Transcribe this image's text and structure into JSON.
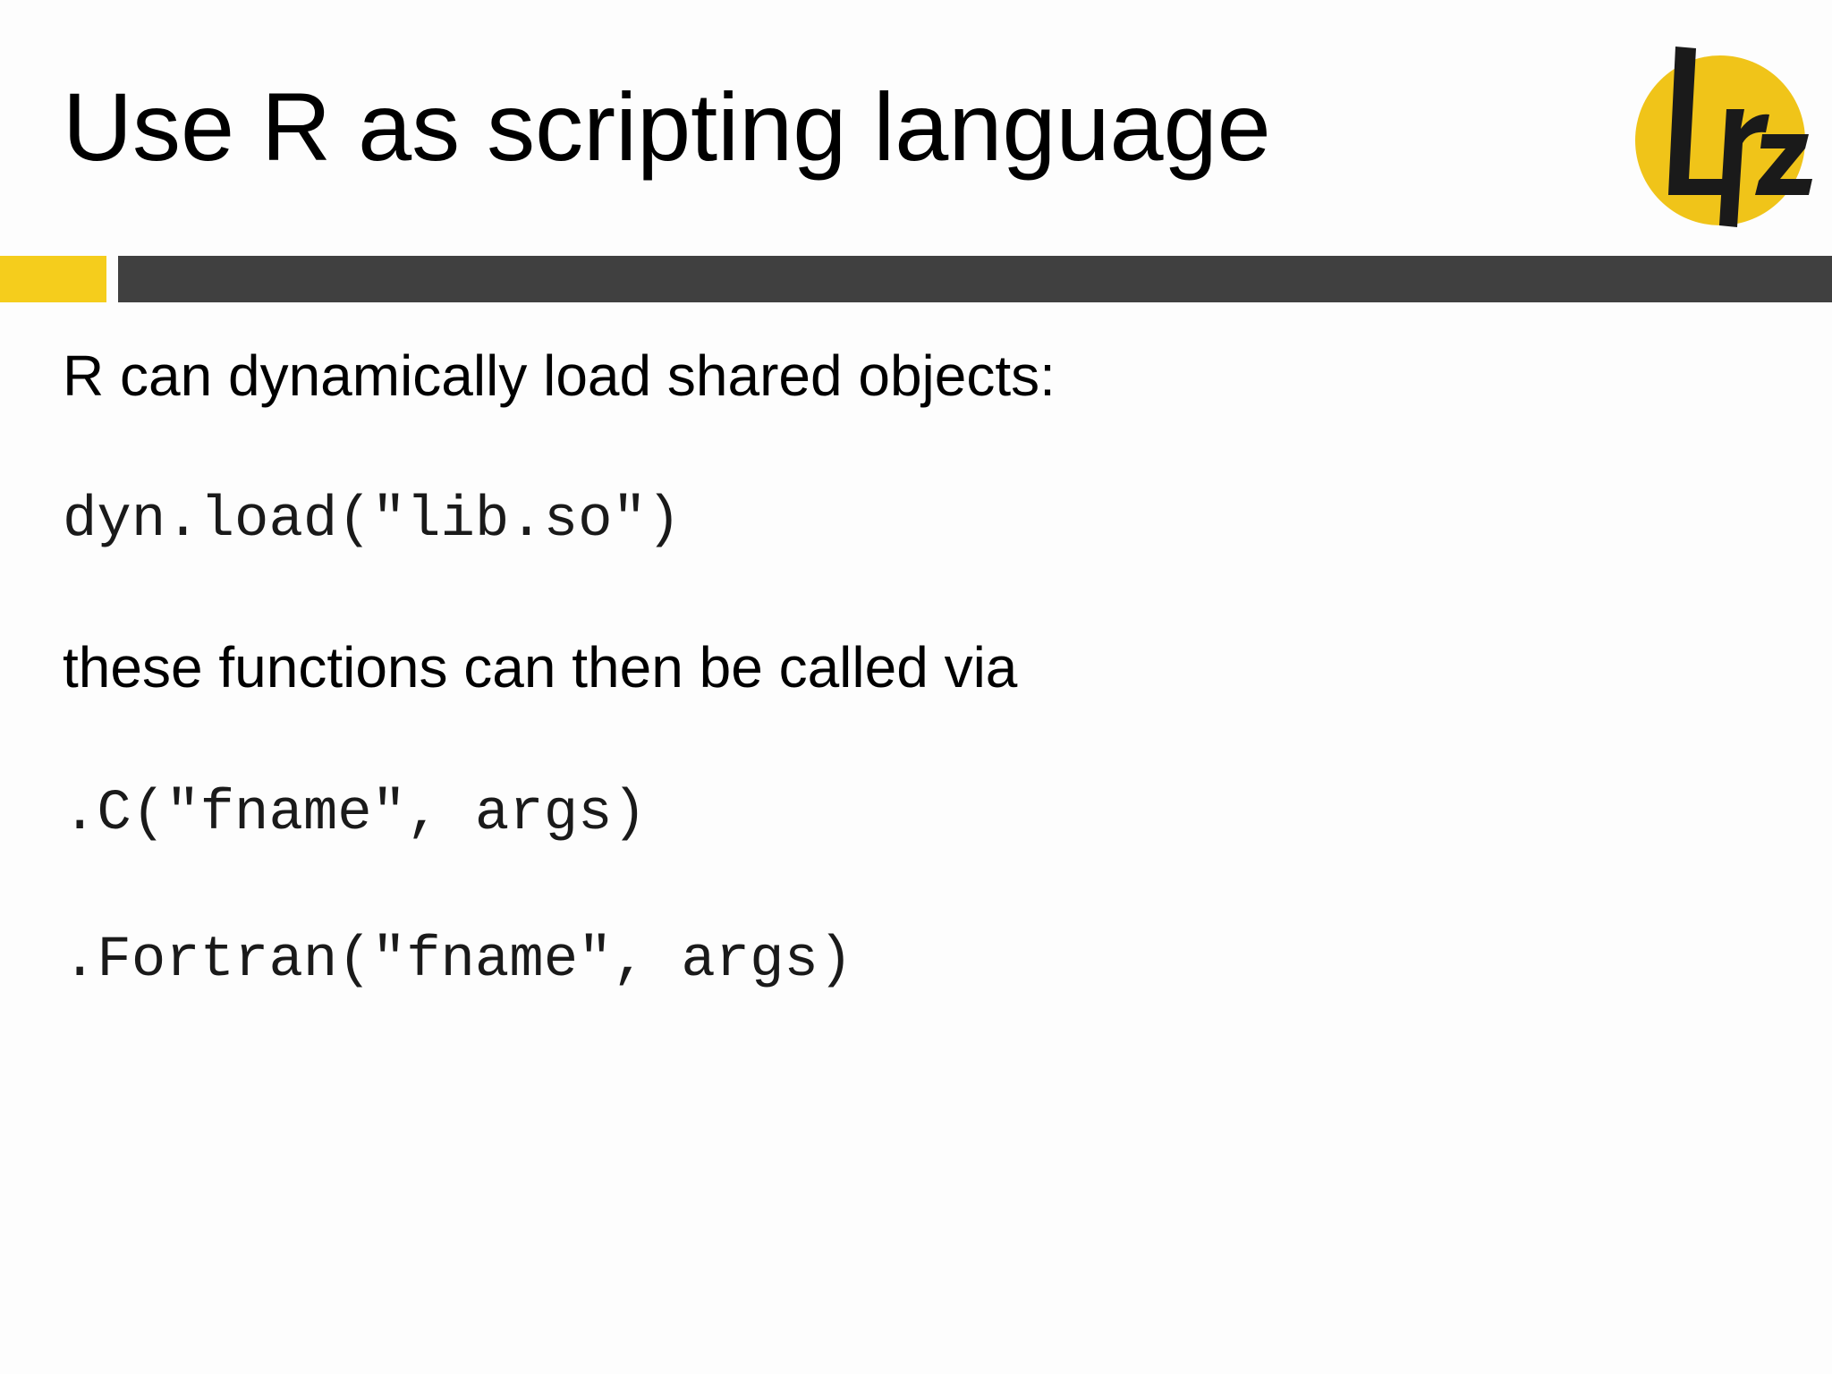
{
  "slide": {
    "title": "Use R as scripting language",
    "logo": {
      "text": "lrz",
      "colors": {
        "circle": "#f0c419",
        "ink": "#1a1a1a"
      }
    },
    "colors": {
      "accent": "#f5cd1c",
      "bar": "#404040",
      "background": "#fdfdfd"
    },
    "body": {
      "intro": "R can dynamically load shared objects:",
      "load_code": "dyn.load(\"lib.so\")",
      "call_text": "these functions can then be called via",
      "c_call_code": ".C(\"fname\", args)",
      "fortran_call_code": ".Fortran(\"fname\", args)"
    }
  }
}
